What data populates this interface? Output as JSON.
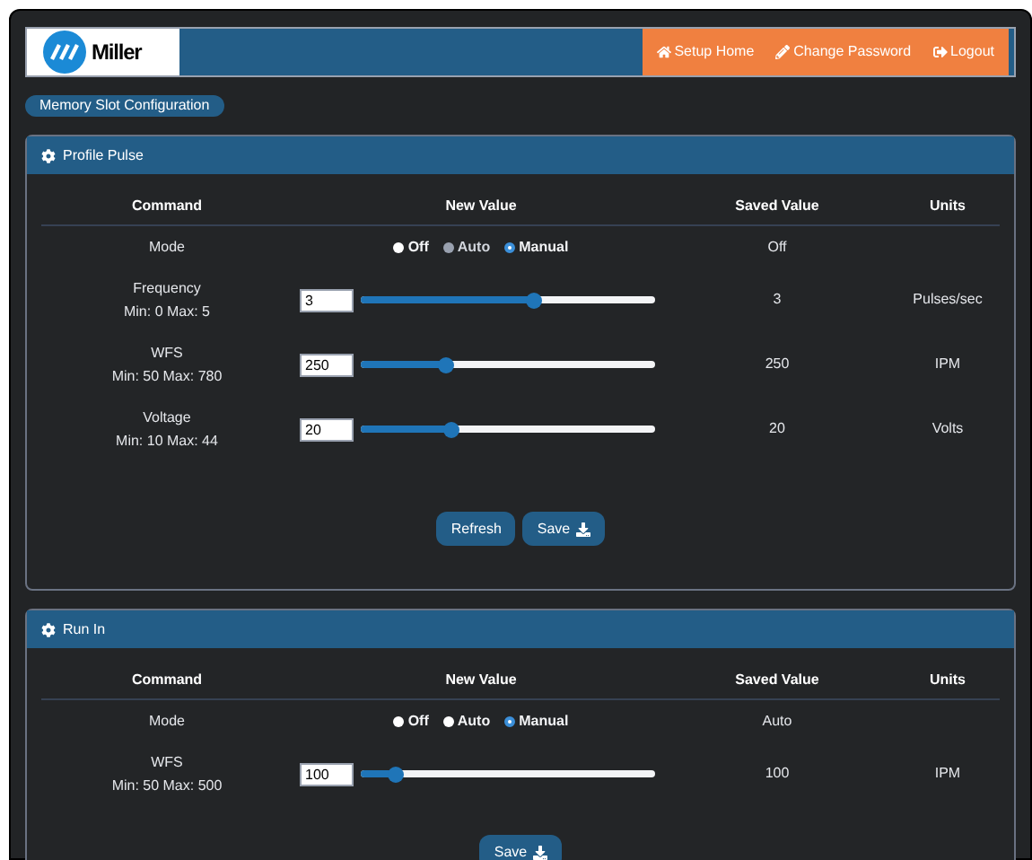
{
  "header": {
    "logo_text": "Miller",
    "nav": [
      {
        "kind": "home",
        "label": "Setup Home"
      },
      {
        "kind": "edit",
        "label": "Change Password"
      },
      {
        "kind": "logout",
        "label": "Logout"
      }
    ]
  },
  "breadcrumb_button": "Memory Slot Configuration",
  "panels": [
    {
      "title": "Profile Pulse",
      "columns": [
        "Command",
        "New Value",
        "Saved Value",
        "Units"
      ],
      "rows": [
        {
          "kind": "mode",
          "command": "Mode",
          "options": [
            {
              "label": "Off",
              "selected": false,
              "disabled": false
            },
            {
              "label": "Auto",
              "selected": false,
              "disabled": true
            },
            {
              "label": "Manual",
              "selected": true,
              "disabled": false
            }
          ],
          "saved": "Off"
        },
        {
          "kind": "slider",
          "command": "Frequency",
          "range": "Min: 0 Max: 5",
          "value": "3",
          "level": 0.59,
          "saved": "3",
          "units": "Pulses/sec"
        },
        {
          "kind": "slider",
          "command": "WFS",
          "range": "Min: 50 Max: 780",
          "value": "250",
          "level": 0.29,
          "saved": "250",
          "units": "IPM"
        },
        {
          "kind": "slider",
          "command": "Voltage",
          "range": "Min: 10 Max: 44",
          "value": "20",
          "level": 0.31,
          "saved": "20",
          "units": "Volts"
        }
      ],
      "buttons": [
        {
          "kind": "refresh",
          "label": "Refresh"
        },
        {
          "kind": "save",
          "label": "Save"
        }
      ]
    },
    {
      "title": "Run In",
      "columns": [
        "Command",
        "New Value",
        "Saved Value",
        "Units"
      ],
      "rows": [
        {
          "kind": "mode",
          "command": "Mode",
          "options": [
            {
              "label": "Off",
              "selected": false,
              "disabled": false
            },
            {
              "label": "Auto",
              "selected": false,
              "disabled": false
            },
            {
              "label": "Manual",
              "selected": true,
              "disabled": false
            }
          ],
          "saved": "Auto"
        },
        {
          "kind": "slider",
          "command": "WFS",
          "range": "Min: 50 Max: 500",
          "value": "100",
          "level": 0.12,
          "saved": "100",
          "units": "IPM"
        }
      ],
      "buttons": [
        {
          "kind": "save",
          "label": "Save"
        }
      ]
    }
  ]
}
